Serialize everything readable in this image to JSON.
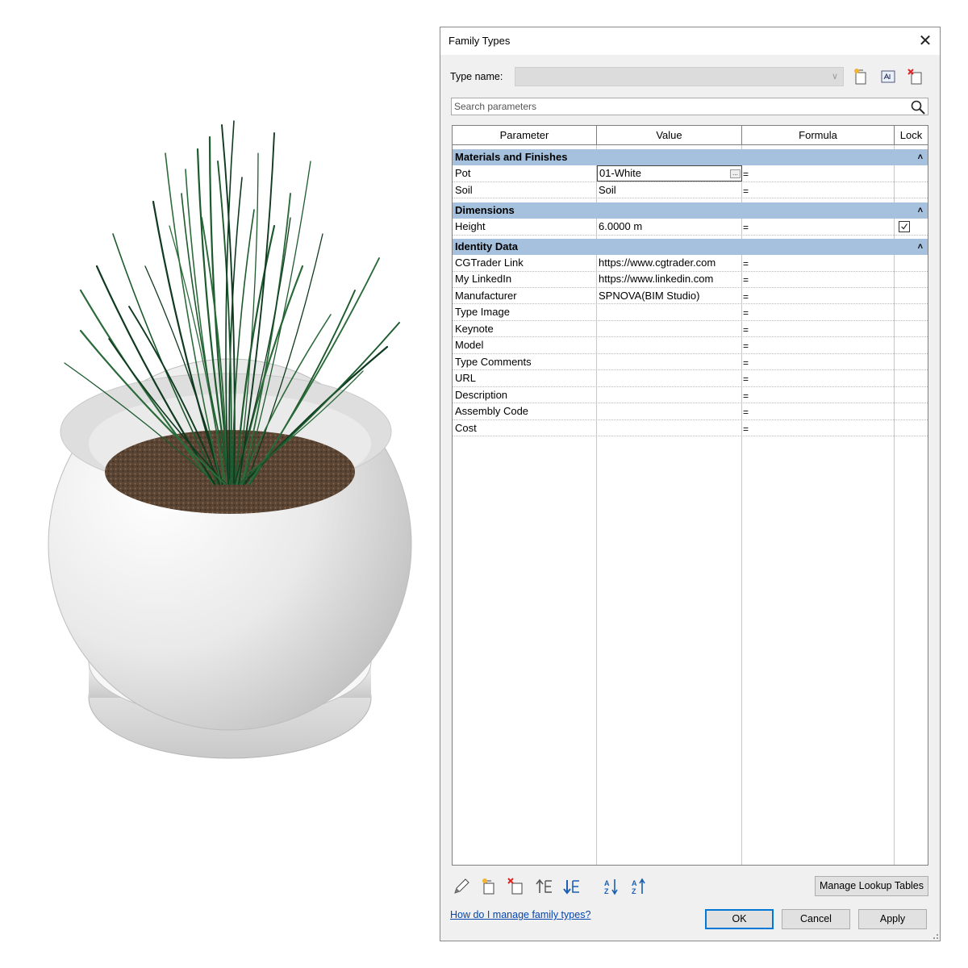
{
  "dialog": {
    "title": "Family Types",
    "type_name_label": "Type name:",
    "type_name_value": "",
    "search_placeholder": "Search parameters"
  },
  "grid": {
    "headers": [
      "Parameter",
      "Value",
      "Formula",
      "Lock"
    ],
    "groups": [
      {
        "name": "Materials and Finishes",
        "rows": [
          {
            "parameter": "Pot",
            "value": "01-White",
            "formula": "="
          },
          {
            "parameter": "Soil",
            "value": "Soil",
            "formula": "="
          }
        ]
      },
      {
        "name": "Dimensions",
        "rows": [
          {
            "parameter": "Height",
            "value": "6.0000 m",
            "formula": "=",
            "locked": true
          }
        ]
      },
      {
        "name": "Identity Data",
        "rows": [
          {
            "parameter": "CGTrader Link",
            "value": "https://www.cgtrader.com",
            "formula": "="
          },
          {
            "parameter": "My LinkedIn",
            "value": "https://www.linkedin.com",
            "formula": "="
          },
          {
            "parameter": "Manufacturer",
            "value": "SPNOVA(BIM Studio)",
            "formula": "="
          },
          {
            "parameter": "Type Image",
            "value": "",
            "formula": "="
          },
          {
            "parameter": "Keynote",
            "value": "",
            "formula": "="
          },
          {
            "parameter": "Model",
            "value": "",
            "formula": "="
          },
          {
            "parameter": "Type Comments",
            "value": "",
            "formula": "="
          },
          {
            "parameter": "URL",
            "value": "",
            "formula": "="
          },
          {
            "parameter": "Description",
            "value": "",
            "formula": "="
          },
          {
            "parameter": "Assembly Code",
            "value": "",
            "formula": "="
          },
          {
            "parameter": "Cost",
            "value": "",
            "formula": "="
          }
        ]
      }
    ]
  },
  "footer": {
    "manage_lookup_label": "Manage Lookup Tables",
    "help_link": "How do I manage family types?",
    "ok_label": "OK",
    "cancel_label": "Cancel",
    "apply_label": "Apply"
  },
  "colors": {
    "group_header": "#a6c1de",
    "ok_border": "#0078d7",
    "link": "#0645ad",
    "foliage": "#0f3a1f",
    "soil": "#5a4433"
  },
  "icons": {
    "top_toolbar": [
      "new-type-icon",
      "rename-type-icon",
      "delete-type-icon"
    ],
    "bottom_toolbar": [
      "edit-parameter-icon",
      "new-parameter-icon",
      "delete-parameter-icon",
      "move-up-icon",
      "move-down-icon",
      "sort-ascending-icon",
      "sort-descending-icon"
    ]
  }
}
